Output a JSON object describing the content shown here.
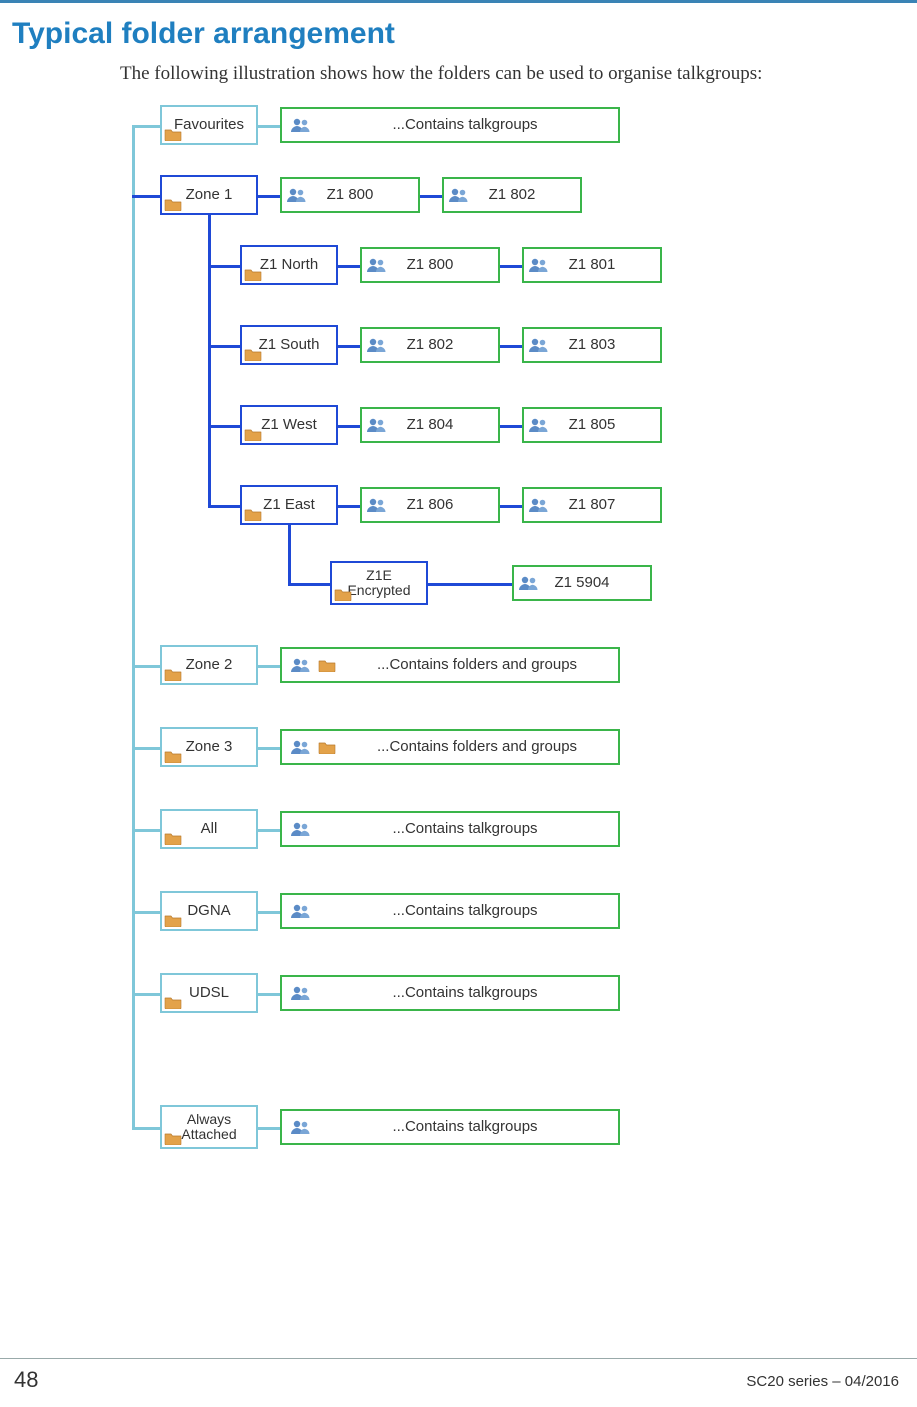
{
  "heading": "Typical folder arrangement",
  "intro": "The following illustration shows how the folders can be used to organise talkgroups:",
  "footer": {
    "page": "48",
    "right": "SC20 series – 04/2016"
  },
  "favourites": {
    "label": "Favourites",
    "desc": "...Contains talkgroups"
  },
  "zone1": {
    "label": "Zone 1",
    "groups": [
      "Z1 800",
      "Z1 802"
    ],
    "subfolders": [
      {
        "label": "Z1 North",
        "groups": [
          "Z1 800",
          "Z1 801"
        ]
      },
      {
        "label": "Z1 South",
        "groups": [
          "Z1 802",
          "Z1 803"
        ]
      },
      {
        "label": "Z1 West",
        "groups": [
          "Z1 804",
          "Z1 805"
        ]
      },
      {
        "label": "Z1 East",
        "groups": [
          "Z1 806",
          "Z1 807"
        ],
        "subfolder": {
          "label_top": "Z1E",
          "label_bottom": "Encrypted",
          "groups": [
            "Z1 5904"
          ]
        }
      }
    ]
  },
  "other_folders": [
    {
      "label": "Zone 2",
      "desc": "...Contains folders and groups",
      "show_folder_icon": true
    },
    {
      "label": "Zone 3",
      "desc": "...Contains folders and groups",
      "show_folder_icon": true
    },
    {
      "label": "All",
      "desc": "...Contains talkgroups",
      "show_folder_icon": false
    },
    {
      "label": "DGNA",
      "desc": "...Contains talkgroups",
      "show_folder_icon": false
    },
    {
      "label": "UDSL",
      "desc": "...Contains talkgroups",
      "show_folder_icon": false
    }
  ],
  "always_attached": {
    "label_top": "Always",
    "label_bottom": "Attached",
    "desc": "...Contains talkgroups"
  }
}
